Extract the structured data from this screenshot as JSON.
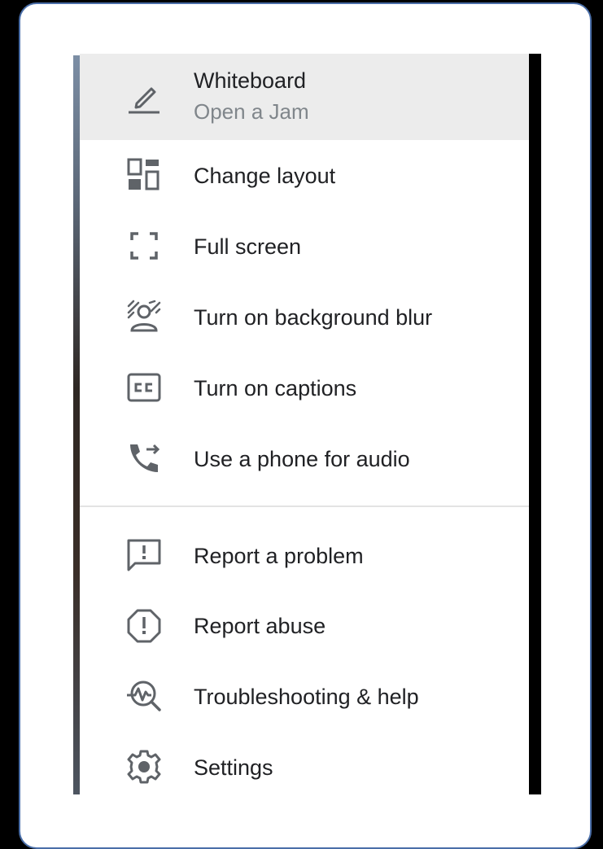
{
  "menu": {
    "items": [
      {
        "label": "Whiteboard",
        "sublabel": "Open a Jam",
        "icon": "pencil-icon"
      },
      {
        "label": "Change layout",
        "icon": "layout-icon"
      },
      {
        "label": "Full screen",
        "icon": "fullscreen-icon"
      },
      {
        "label": "Turn on background blur",
        "icon": "background-blur-icon"
      },
      {
        "label": "Turn on captions",
        "icon": "captions-icon"
      },
      {
        "label": "Use a phone for audio",
        "icon": "phone-audio-icon"
      },
      {
        "label": "Report a problem",
        "icon": "report-problem-icon"
      },
      {
        "label": "Report abuse",
        "icon": "report-abuse-icon"
      },
      {
        "label": "Troubleshooting & help",
        "icon": "troubleshooting-icon"
      },
      {
        "label": "Settings",
        "icon": "settings-icon"
      }
    ]
  },
  "colors": {
    "icon": "#5f6368",
    "text": "#202124",
    "subtext": "#80868b",
    "highlight": "#ececec",
    "frame_border": "#4a6ea8"
  }
}
